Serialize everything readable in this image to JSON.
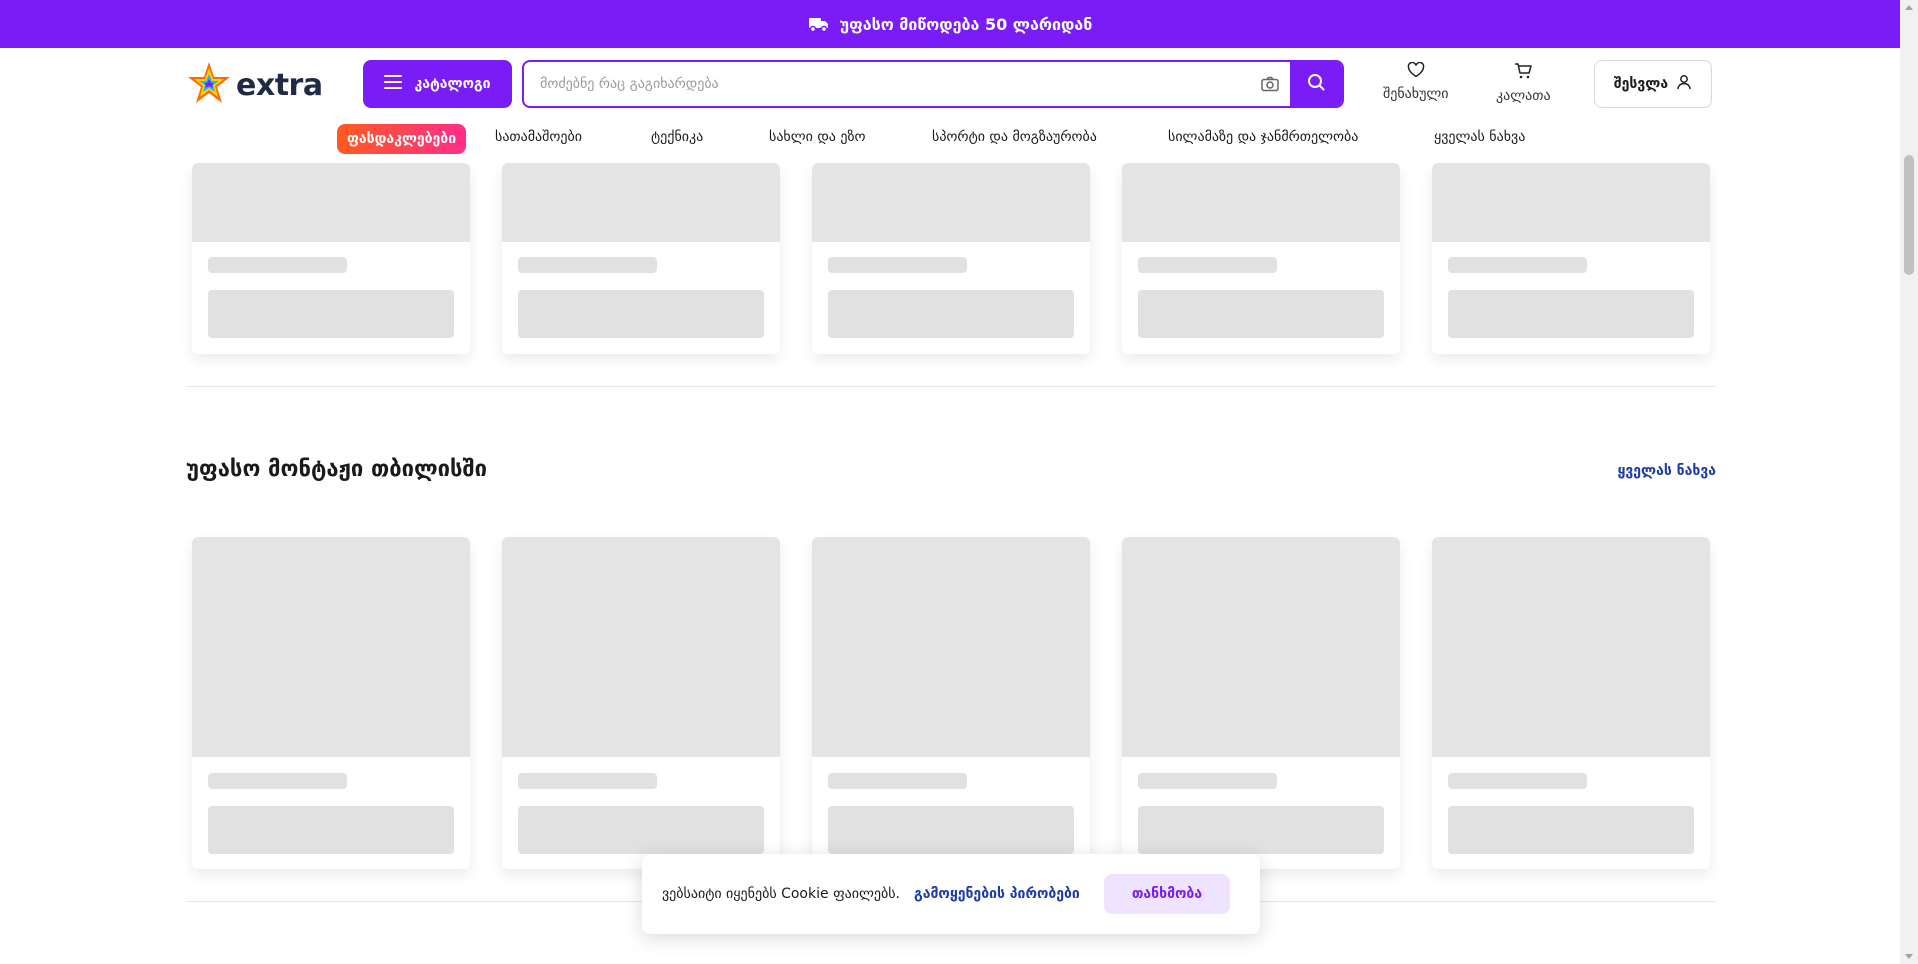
{
  "promo": {
    "text": "უფასო მიწოდება 50 ლარიდან",
    "icon": "truck-icon"
  },
  "header": {
    "logo_text": "extra",
    "catalog_label": "კატალოგი",
    "search": {
      "placeholder": "მოძებნე რაც გაგიხარდება",
      "value": ""
    },
    "favorites_label": "შენახული",
    "cart_label": "კალათა",
    "login_label": "შესვლა"
  },
  "nav": {
    "items": [
      {
        "label": "ფასდაკლებები"
      },
      {
        "label": "სათამაშოები"
      },
      {
        "label": "ტექნიკა"
      },
      {
        "label": "სახლი და ეზო"
      },
      {
        "label": "სპორტი და მოგზაურობა"
      },
      {
        "label": "სილამაზე და ჯანმრთელობა"
      },
      {
        "label": "ყველას ნახვა"
      }
    ]
  },
  "section": {
    "title": "უფასო მონტაჟი თბილისში",
    "see_all": "ყველას ნახვა"
  },
  "cookie": {
    "text": "ვებსაიტი იყენებს Cookie ფაილებს.",
    "link": "გამოყენების პირობები",
    "accept": "თანხმობა"
  },
  "colors": {
    "brand": "#7a1cf6",
    "link": "#1e3aa8",
    "sale_gradient_start": "#ff5a1f",
    "sale_gradient_end": "#ff2d8a",
    "skeleton": "#e4e4e4"
  }
}
